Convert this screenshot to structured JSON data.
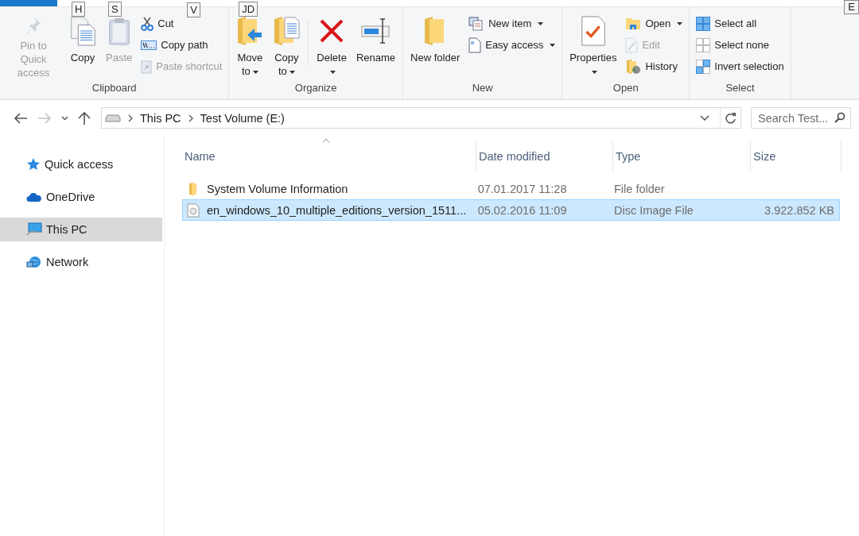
{
  "top_bar": {
    "key_tip": "E"
  },
  "ribbon": {
    "groups": [
      {
        "label": "Clipboard",
        "columns": [
          {
            "kind": "large",
            "items": [
              {
                "label": "Pin to Quick access",
                "disabled": true,
                "dropdown": false
              }
            ]
          },
          {
            "kind": "large",
            "items": [
              {
                "label": "Copy",
                "disabled": false,
                "dropdown": false,
                "key_tip": "H"
              }
            ]
          },
          {
            "kind": "large",
            "items": [
              {
                "label": "Paste",
                "disabled": true,
                "dropdown": false,
                "key_tip": "S"
              }
            ]
          },
          {
            "kind": "small",
            "items": [
              {
                "label": "Cut",
                "disabled": false,
                "dropdown": false,
                "key_tip": "V"
              },
              {
                "label": "Copy path",
                "disabled": false,
                "dropdown": false
              },
              {
                "label": "Paste shortcut",
                "disabled": true,
                "dropdown": false
              }
            ]
          }
        ]
      },
      {
        "label": "Organize",
        "columns": [
          {
            "kind": "large",
            "items": [
              {
                "label": "Move to",
                "disabled": false,
                "dropdown": true,
                "key_tip": "JD"
              }
            ]
          },
          {
            "kind": "large",
            "items": [
              {
                "label": "Copy to",
                "disabled": false,
                "dropdown": true
              }
            ]
          },
          {
            "kind": "divider"
          },
          {
            "kind": "large",
            "items": [
              {
                "label": "Delete",
                "disabled": false,
                "dropdown": true
              }
            ]
          },
          {
            "kind": "large",
            "items": [
              {
                "label": "Rename",
                "disabled": false,
                "dropdown": false
              }
            ]
          }
        ]
      },
      {
        "label": "New",
        "columns": [
          {
            "kind": "large",
            "items": [
              {
                "label": "New folder",
                "disabled": false,
                "dropdown": false
              }
            ]
          },
          {
            "kind": "small",
            "items": [
              {
                "label": "New item",
                "disabled": false,
                "dropdown": true
              },
              {
                "label": "Easy access",
                "disabled": false,
                "dropdown": true
              }
            ]
          }
        ]
      },
      {
        "label": "Open",
        "columns": [
          {
            "kind": "large",
            "items": [
              {
                "label": "Properties",
                "disabled": false,
                "dropdown": true
              }
            ]
          },
          {
            "kind": "small",
            "items": [
              {
                "label": "Open",
                "disabled": false,
                "dropdown": true
              },
              {
                "label": "Edit",
                "disabled": true,
                "dropdown": false
              },
              {
                "label": "History",
                "disabled": false,
                "dropdown": false
              }
            ]
          }
        ]
      },
      {
        "label": "Select",
        "columns": [
          {
            "kind": "small",
            "items": [
              {
                "label": "Select all",
                "disabled": false,
                "dropdown": false
              },
              {
                "label": "Select none",
                "disabled": false,
                "dropdown": false
              },
              {
                "label": "Invert selection",
                "disabled": false,
                "dropdown": false
              }
            ]
          }
        ]
      }
    ]
  },
  "address_bar": {
    "back_disabled": false,
    "forward_disabled": true,
    "path": [
      "This PC",
      "Test Volume (E:)"
    ],
    "search": {
      "placeholder": "Search Test..."
    }
  },
  "sidebar": {
    "items": [
      {
        "label": "Quick access",
        "selected": false
      },
      {
        "label": "OneDrive",
        "selected": false
      },
      {
        "label": "This PC",
        "selected": true
      },
      {
        "label": "Network",
        "selected": false
      }
    ]
  },
  "file_list": {
    "columns": [
      "Name",
      "Date modified",
      "Type",
      "Size"
    ],
    "rows": [
      {
        "kind": "folder",
        "name": "System Volume Information",
        "date_modified": "07.01.2017 11:28",
        "type": "File folder",
        "selected": false
      },
      {
        "kind": "disc-image",
        "name": "en_windows_10_multiple_editions_version_1511...",
        "date_modified": "05.02.2016 11:09",
        "type": "Disc Image File",
        "size": "3.922.852 KB",
        "selected": true
      }
    ]
  }
}
